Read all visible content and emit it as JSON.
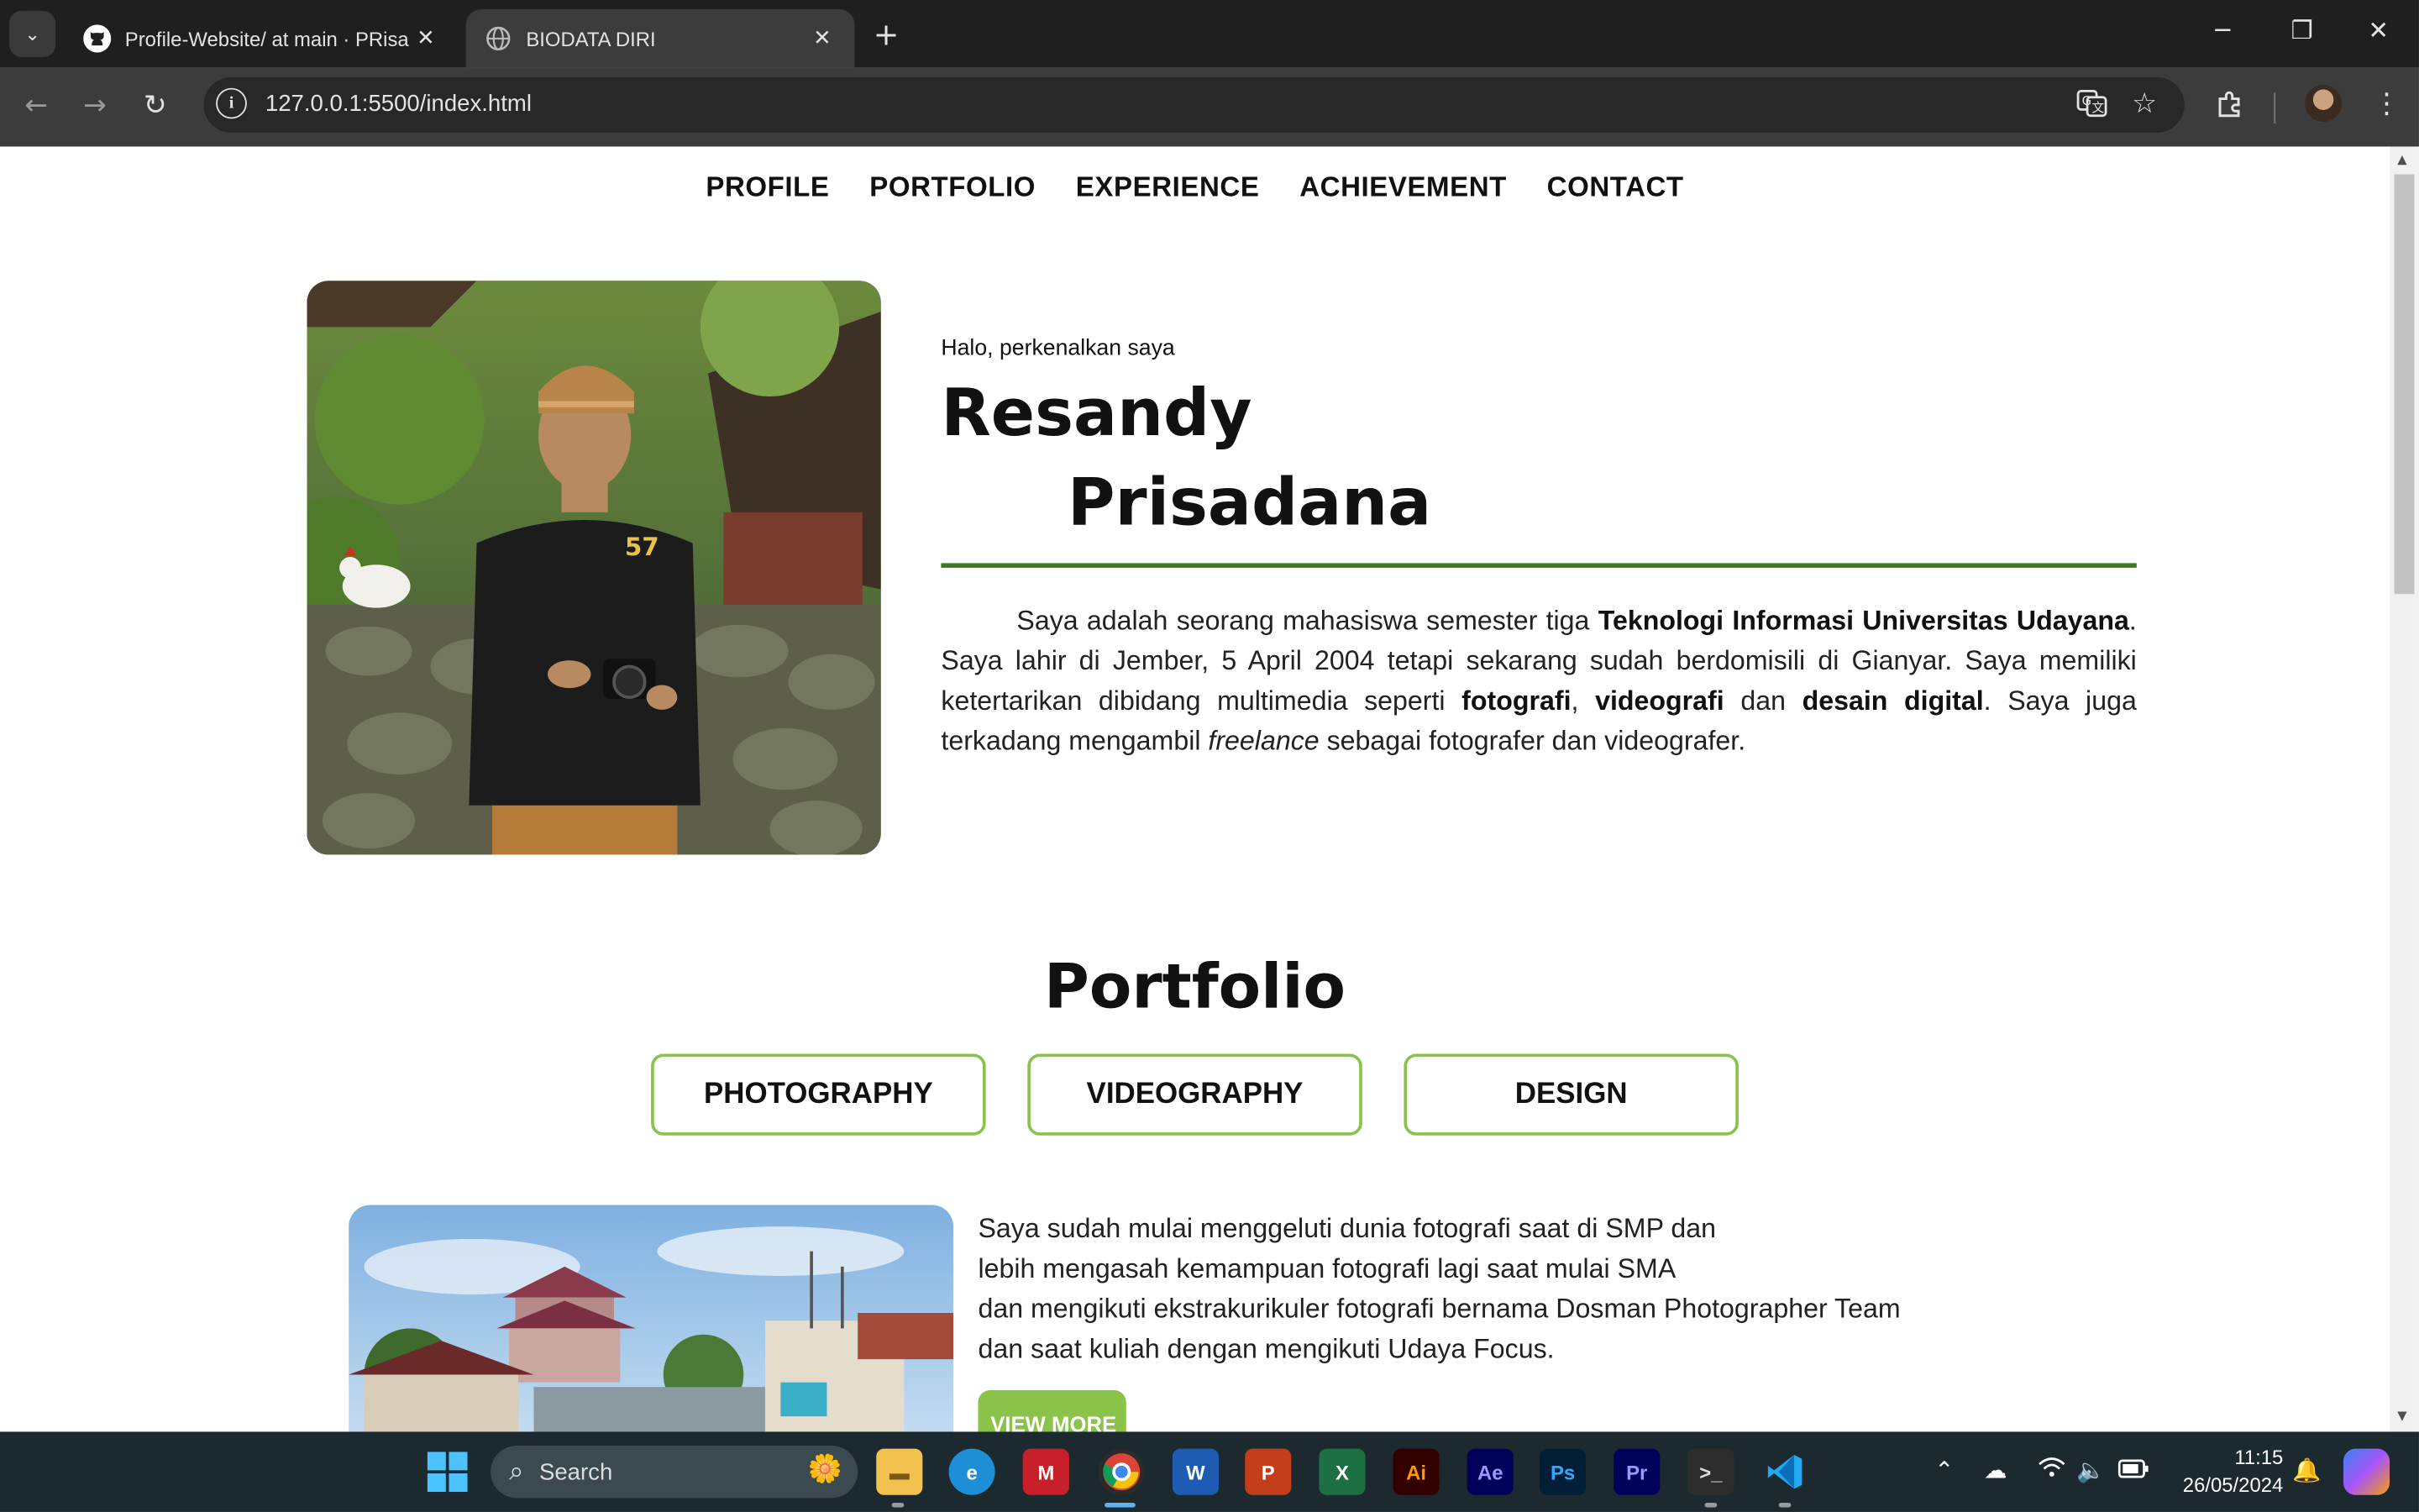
{
  "browser": {
    "tabs": [
      {
        "title": "Profile-Website/ at main · PRisa",
        "favicon": "github-icon",
        "active": false
      },
      {
        "title": "BIODATA DIRI",
        "favicon": "globe-icon",
        "active": true
      }
    ],
    "url": "127.0.0.1:5500/index.html"
  },
  "nav": {
    "items": [
      "PROFILE",
      "PORTFOLIO",
      "EXPERIENCE",
      "ACHIEVEMENT",
      "CONTACT"
    ]
  },
  "hero": {
    "greeting": "Halo, perkenalkan saya",
    "first_name": "Resandy",
    "last_name": "Prisadana",
    "about": {
      "s1": "Saya adalah seorang mahasiswa semester tiga ",
      "b1": "Teknologi Informasi Universitas Udayana",
      "s2": ". Saya lahir di Jember, 5 April 2004 tetapi sekarang sudah berdomisili di Gianyar. Saya memiliki ketertarikan dibidang multimedia seperti ",
      "b2": "fotografi",
      "s3": ", ",
      "b3": "videografi",
      "s4": " dan ",
      "b4": "desain digital",
      "s5": ". Saya juga terkadang mengambil ",
      "i1": "freelance",
      "s6": " sebagai fotografer dan videografer."
    }
  },
  "portfolio": {
    "title": "Portfolio",
    "tabs": [
      "PHOTOGRAPHY",
      "VIDEOGRAPHY",
      "DESIGN"
    ],
    "description_lines": [
      "Saya sudah mulai menggeluti dunia fotografi saat di SMP dan",
      "lebih mengasah kemampuan fotografi lagi saat mulai SMA",
      "dan mengikuti ekstrakurikuler fotografi bernama Dosman Photographer Team",
      "dan saat kuliah dengan mengikuti Udaya Focus."
    ],
    "view_more": "VIEW MORE"
  },
  "taskbar": {
    "search_label": "Search",
    "time": "11:15",
    "date": "26/05/2024"
  },
  "colors": {
    "accent_green": "#3d7a1e",
    "tab_border": "#8bc34a",
    "button_green": "#8bc34a"
  }
}
